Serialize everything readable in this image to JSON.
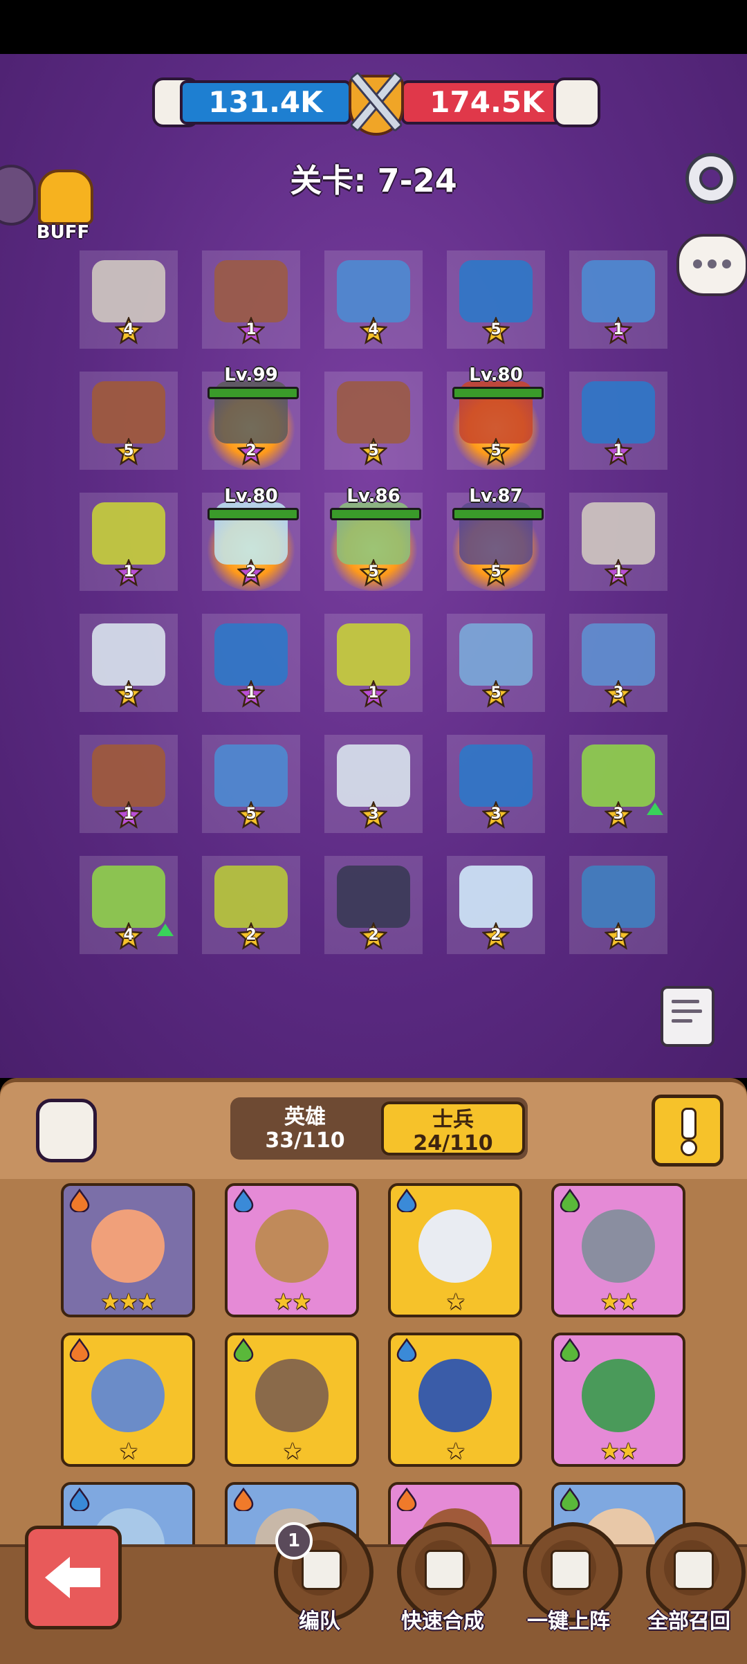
{
  "header": {
    "player_power": "131.4K",
    "enemy_power": "174.5K",
    "stage_label": "关卡: 7-24"
  },
  "buff_label": "BUFF",
  "board": [
    {
      "star": "4",
      "unit": "skeleton-dragon",
      "color": "#cfc8c0",
      "star_color": "#f6c22a"
    },
    {
      "star": "1",
      "unit": "mace-brute",
      "color": "#9b5b45",
      "star_color": "#b94fd6"
    },
    {
      "star": "4",
      "unit": "spearmen",
      "color": "#4d8bd1",
      "star_color": "#f6c22a"
    },
    {
      "star": "5",
      "unit": "axe-ogres",
      "color": "#2e78c8",
      "star_color": "#f6c22a"
    },
    {
      "star": "1",
      "unit": "spearmen",
      "color": "#4d8bd1",
      "star_color": "#b94fd6"
    },
    {
      "star": "5",
      "unit": "archers",
      "color": "#a05a3a",
      "star_color": "#f6c22a"
    },
    {
      "star": "2",
      "unit": "hero",
      "color": "#5a5a5a",
      "star_color": "#b94fd6",
      "level": "Lv.99"
    },
    {
      "star": "5",
      "unit": "mace-brute",
      "color": "#9b5b45",
      "star_color": "#f6c22a"
    },
    {
      "star": "5",
      "unit": "hero",
      "color": "#c8452a",
      "star_color": "#f6c22a",
      "level": "Lv.80"
    },
    {
      "star": "1",
      "unit": "shield-troops",
      "color": "#2e78c8",
      "star_color": "#b94fd6"
    },
    {
      "star": "1",
      "unit": "goblins",
      "color": "#c7cf3a",
      "star_color": "#b94fd6"
    },
    {
      "star": "2",
      "unit": "hero",
      "color": "#bfe8f2",
      "star_color": "#b94fd6",
      "level": "Lv.80"
    },
    {
      "star": "5",
      "unit": "hero",
      "color": "#8cc27a",
      "star_color": "#f6c22a",
      "level": "Lv.86"
    },
    {
      "star": "5",
      "unit": "hero",
      "color": "#5b4a8a",
      "star_color": "#f6c22a",
      "level": "Lv.87"
    },
    {
      "star": "1",
      "unit": "skeleton-dragon",
      "color": "#cfc8c0",
      "star_color": "#b94fd6"
    },
    {
      "star": "5",
      "unit": "skeletons",
      "color": "#d8e2ec",
      "star_color": "#f6c22a"
    },
    {
      "star": "1",
      "unit": "shield-troops",
      "color": "#2e78c8",
      "star_color": "#b94fd6"
    },
    {
      "star": "1",
      "unit": "goblins",
      "color": "#c7cf3a",
      "star_color": "#b94fd6"
    },
    {
      "star": "5",
      "unit": "wyvern",
      "color": "#7aa8d8",
      "star_color": "#f6c22a"
    },
    {
      "star": "3",
      "unit": "blue-dragon",
      "color": "#5e8fd0",
      "star_color": "#f6c22a"
    },
    {
      "star": "1",
      "unit": "archers",
      "color": "#a05a3a",
      "star_color": "#b94fd6"
    },
    {
      "star": "5",
      "unit": "spearmen",
      "color": "#4d8bd1",
      "star_color": "#f6c22a"
    },
    {
      "star": "3",
      "unit": "skeletons",
      "color": "#d8e2ec",
      "star_color": "#f6c22a"
    },
    {
      "star": "3",
      "unit": "axe-ogres",
      "color": "#2e78c8",
      "star_color": "#f6c22a"
    },
    {
      "star": "3",
      "unit": "green-beast",
      "color": "#8fd04a",
      "star_color": "#f6c22a",
      "upgrade": true
    },
    {
      "star": "4",
      "unit": "green-beast",
      "color": "#8fd04a",
      "star_color": "#f6c22a",
      "upgrade": true
    },
    {
      "star": "2",
      "unit": "bees",
      "color": "#b8c83a",
      "star_color": "#f6c22a"
    },
    {
      "star": "2",
      "unit": "dark-cavalry",
      "color": "#3a3a55",
      "star_color": "#f6c22a"
    },
    {
      "star": "2",
      "unit": "ice-spirits",
      "color": "#cfe8f8",
      "star_color": "#f6c22a"
    },
    {
      "star": "1",
      "unit": "cannon-golem",
      "color": "#3f7fc0",
      "star_color": "#f6c22a"
    }
  ],
  "panel": {
    "tab_hero_label": "英雄",
    "tab_hero_count": "33/110",
    "tab_soldier_label": "士兵",
    "tab_soldier_count": "24/110"
  },
  "cards": [
    {
      "element": "fire",
      "stars": "★★★",
      "bg": "#7b6fa8",
      "face": "#f0a07a"
    },
    {
      "element": "water",
      "stars": "★★",
      "bg": "#e58ad6",
      "face": "#c08a5a"
    },
    {
      "element": "water",
      "stars": "★",
      "bg": "#f6c22a",
      "face": "#e9ecf2"
    },
    {
      "element": "leaf",
      "stars": "★★",
      "bg": "#e58ad6",
      "face": "#8a8ea0"
    },
    {
      "element": "fire",
      "stars": "★",
      "bg": "#f6c22a",
      "face": "#6b8cc8"
    },
    {
      "element": "leaf",
      "stars": "★",
      "bg": "#f6c22a",
      "face": "#8a6a4a"
    },
    {
      "element": "water",
      "stars": "★",
      "bg": "#f6c22a",
      "face": "#3a5ca8"
    },
    {
      "element": "leaf",
      "stars": "★★",
      "bg": "#e58ad6",
      "face": "#4a9a5a"
    },
    {
      "element": "water",
      "stars": "",
      "bg": "#7fa8e0",
      "face": "#a8c8e8"
    },
    {
      "element": "fire",
      "stars": "",
      "bg": "#7fa8e0",
      "face": "#c8b8a8"
    },
    {
      "element": "fire",
      "stars": "",
      "bg": "#e58ad6",
      "face": "#a05a3a"
    },
    {
      "element": "leaf",
      "stars": "",
      "bg": "#7fa8e0",
      "face": "#e8c8a8"
    }
  ],
  "nav": {
    "formation_badge": "1",
    "formation_label": "编队",
    "quick_merge_label": "快速合成",
    "deploy_label": "一键上阵",
    "recall_label": "全部召回"
  },
  "colors": {
    "player_blue": "#1e7fd1",
    "enemy_red": "#e0384a",
    "arena_purple": "#5b2a82",
    "panel_brown": "#b07c4c",
    "gold": "#f6c22a"
  }
}
